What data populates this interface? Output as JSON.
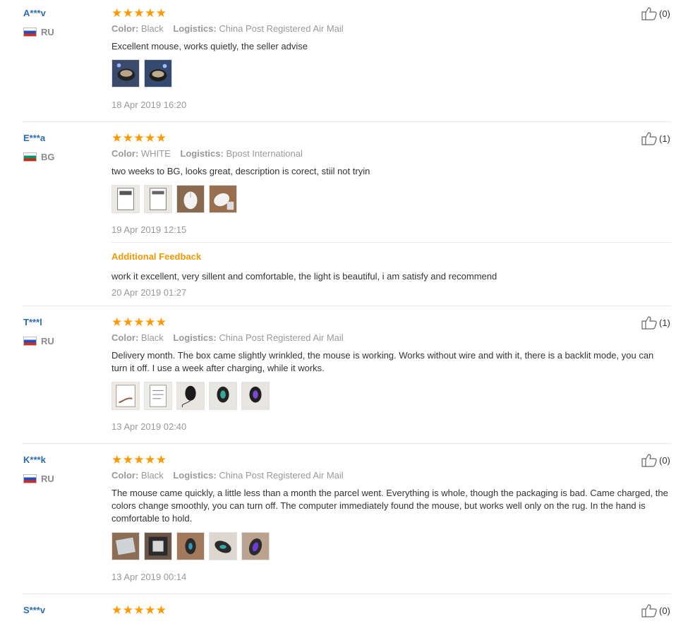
{
  "labels": {
    "color": "Color:",
    "logistics": "Logistics:",
    "additional_feedback": "Additional Feedback",
    "star": "★"
  },
  "colors": {
    "star": "#ff9900",
    "username": "#2b6cb0",
    "additional": "#f39800"
  },
  "reviews": [
    {
      "user": "A***v",
      "country": "RU",
      "flag": "ru",
      "rating": 5,
      "color": "Black",
      "logistics": "China Post Registered Air Mail",
      "text": "Excellent mouse, works quietly, the seller advise",
      "photos": [
        "mouse-photo",
        "mouse-photo"
      ],
      "date": "18 Apr 2019 16:20",
      "likes": "(0)"
    },
    {
      "user": "E***a",
      "country": "BG",
      "flag": "bg",
      "rating": 5,
      "color": "WHITE",
      "logistics": "Bpost International",
      "text": "two weeks to BG, looks great, description is corect, stiil not tryin",
      "photos": [
        "box-photo",
        "box-photo",
        "mouse-photo",
        "mouse-photo"
      ],
      "date": "19 Apr 2019 12:15",
      "likes": "(1)",
      "additional": {
        "text": "work it excellent, very sillent and comfortable, the light is beautiful, i am satisfy and recommend",
        "date": "20 Apr 2019 01:27"
      }
    },
    {
      "user": "T***l",
      "country": "RU",
      "flag": "ru",
      "rating": 5,
      "color": "Black",
      "logistics": "China Post Registered Air Mail",
      "text": "Delivery month. The box came slightly wrinkled, the mouse is working. Works without wire and with it, there is a backlit mode, you can turn it off. I use a week after charging, while it works.",
      "photos": [
        "box-photo",
        "box-photo",
        "mouse-photo",
        "mouse-photo",
        "mouse-photo"
      ],
      "date": "13 Apr 2019 02:40",
      "likes": "(1)"
    },
    {
      "user": "K***k",
      "country": "RU",
      "flag": "ru",
      "rating": 5,
      "color": "Black",
      "logistics": "China Post Registered Air Mail",
      "text": "The mouse came quickly, a little less than a month the parcel went. Everything is whole, though the packaging is bad. Came charged, the colors change smoothly, you can turn off. The computer immediately found the mouse, but works well only on the rug. In the hand is comfortable to hold.",
      "photos": [
        "package-photo",
        "package-photo",
        "mouse-photo",
        "mouse-photo",
        "mouse-photo"
      ],
      "date": "13 Apr 2019 00:14",
      "likes": "(0)"
    },
    {
      "user": "S***v",
      "rating": 5,
      "likes": "(0)"
    }
  ]
}
